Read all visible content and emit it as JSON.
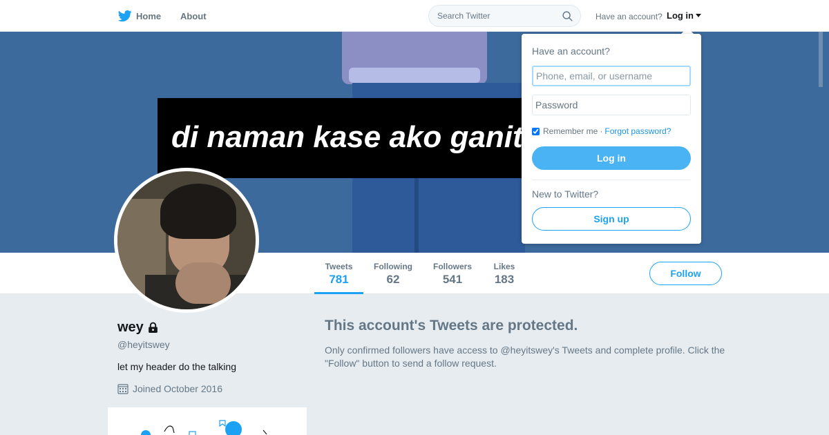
{
  "nav": {
    "home_label": "Home",
    "about_label": "About",
    "search_placeholder": "Search Twitter",
    "have_account": "Have an account?",
    "login_label": "Log in"
  },
  "banner": {
    "caption": "di naman kase ako ganit"
  },
  "profile": {
    "name": "wey",
    "handle": "@heyitswey",
    "bio": "let my header do the talking",
    "joined": "Joined October 2016",
    "protected": true
  },
  "stats": [
    {
      "label": "Tweets",
      "value": "781",
      "active": true
    },
    {
      "label": "Following",
      "value": "62",
      "active": false
    },
    {
      "label": "Followers",
      "value": "541",
      "active": false
    },
    {
      "label": "Likes",
      "value": "183",
      "active": false
    }
  ],
  "follow_button": "Follow",
  "protected_notice": {
    "title": "This account's Tweets are protected.",
    "text": "Only confirmed followers have access to @heyitswey's Tweets and complete profile. Click the \"Follow\" button to send a follow request."
  },
  "login_dropdown": {
    "heading": "Have an account?",
    "username_placeholder": "Phone, email, or username",
    "password_placeholder": "Password",
    "remember_me": "Remember me",
    "remember_checked": true,
    "separator": "·",
    "forgot_password": "Forgot password?",
    "login_button": "Log in",
    "new_to_twitter": "New to Twitter?",
    "signup_button": "Sign up"
  },
  "colors": {
    "accent": "#1da1f2",
    "login_button": "#4ab3f4",
    "page_background": "#e6ecf0",
    "banner": "#3d6a9c"
  },
  "icons": [
    "twitter-bird-icon",
    "search-icon",
    "caret-down-icon",
    "lock-icon",
    "calendar-icon"
  ]
}
